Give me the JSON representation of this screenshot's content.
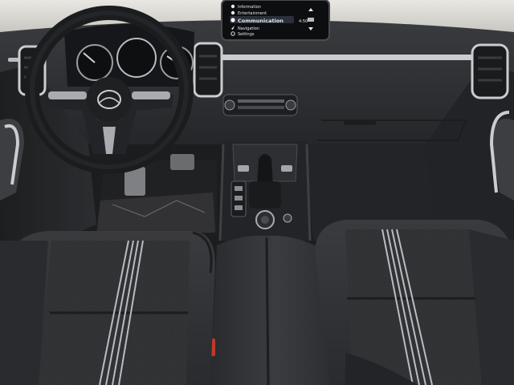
{
  "scene": {
    "type": "photo",
    "subject": "car-interior-dashboard",
    "brand_logo": "mazda-logo"
  },
  "infotainment": {
    "menu": [
      {
        "label": "Information",
        "icon": "info-icon"
      },
      {
        "label": "Entertainment",
        "icon": "music-icon"
      },
      {
        "label": "Communication",
        "icon": "phone-icon",
        "selected": true
      },
      {
        "label": "Navigation",
        "icon": "navigation-icon"
      },
      {
        "label": "Settings",
        "icon": "gear-icon"
      }
    ],
    "clock": "4:50"
  },
  "colors": {
    "seat_fabric": "#2f3033",
    "seat_stripe": "#b9bcc1",
    "dash": "#2c2d30",
    "trim_silver": "#c9ccd0",
    "screen_accent": "#e6e8ec"
  }
}
